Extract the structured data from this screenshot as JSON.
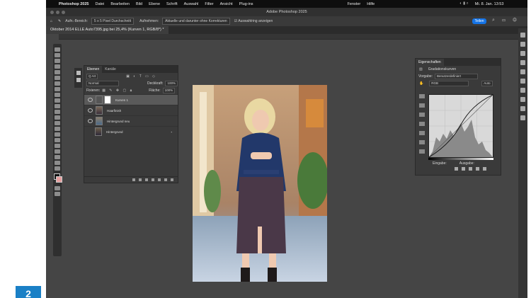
{
  "menubar": {
    "apple": "",
    "items": [
      "Photoshop 2025",
      "Datei",
      "Bearbeiten",
      "Bild",
      "Ebene",
      "Schrift",
      "Auswahl",
      "Filter",
      "Ansicht",
      "Plug-ins"
    ],
    "right_items": [
      "Fenster",
      "Hilfe"
    ],
    "clock": "Mi. 8. Jan. 13:53"
  },
  "window": {
    "title": "Adobe Photoshop 2025"
  },
  "options_bar": {
    "sample_size_label": "Aufn.-Bereich:",
    "sample_size_value": "5 x 5 Pixel Durchschnitt",
    "sample_label": "Aufnehmen:",
    "sample_value": "Aktuelle und darunter ohne Korrekturen",
    "show_ring_label": "Auswahlring anzeigen",
    "share_label": "Teilen"
  },
  "document_tab": {
    "label": "Oktober 2014 ELLE Auto7395.jpg bei 25,4% (Kurven 1, RGB/8*) *"
  },
  "layers_panel": {
    "tabs": [
      "Ebenen",
      "Kanäle"
    ],
    "kind_label": "Q Art",
    "blend_mode": "Normal",
    "opacity_label": "Deckkraft:",
    "opacity_value": "100%",
    "lock_label": "Fixieren:",
    "fill_label": "Fläche:",
    "fill_value": "100%",
    "layers": [
      "Kurven 1",
      "Haarfinish",
      "Hintergrund neu",
      "Hintergrund"
    ]
  },
  "properties_panel": {
    "title": "Eigenschaften",
    "subtitle": "Gradationskurven",
    "preset_label": "Vorgabe:",
    "preset_value": "Benutzerdefiniert",
    "channel_value": "RGB",
    "auto_label": "Auto",
    "input_label": "Eingabe:",
    "output_label": "Ausgabe:"
  },
  "badge": {
    "text": "2"
  },
  "colors": {
    "app_bg": "#454545",
    "accent": "#1473e6",
    "badge": "#1a80c6"
  }
}
